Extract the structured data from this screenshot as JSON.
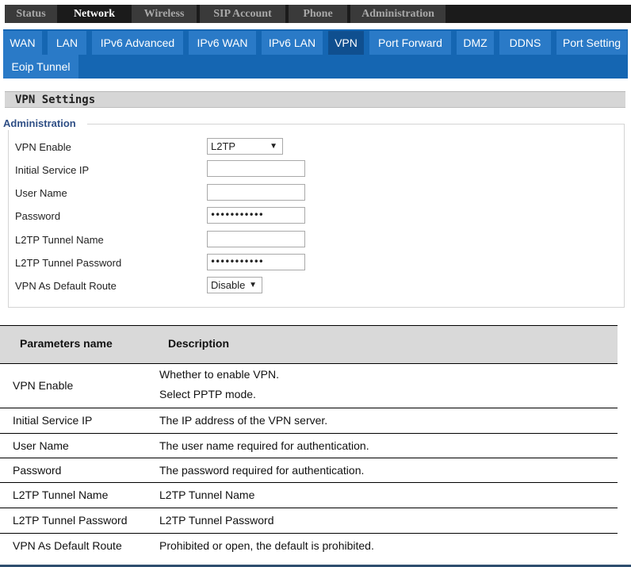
{
  "top_tabs": [
    "Status",
    "Network",
    "Wireless",
    "SIP Account",
    "Phone",
    "Administration"
  ],
  "active_top_tab": "Network",
  "sub_tabs": [
    "WAN",
    "LAN",
    "IPv6 Advanced",
    "IPv6 WAN",
    "IPv6 LAN",
    "VPN",
    "Port Forward",
    "DMZ",
    "DDNS",
    "Port Setting",
    "Eoip Tunnel"
  ],
  "active_sub_tab": "VPN",
  "section_title": "VPN Settings",
  "fieldset_legend": "Administration",
  "form": {
    "vpn_enable": {
      "label": "VPN Enable",
      "value": "L2TP"
    },
    "initial_service_ip": {
      "label": "Initial Service IP",
      "value": ""
    },
    "user_name": {
      "label": "User Name",
      "value": ""
    },
    "password": {
      "label": "Password",
      "value": "•••••••••••"
    },
    "l2tp_tunnel_name": {
      "label": "L2TP Tunnel Name",
      "value": ""
    },
    "l2tp_tunnel_password": {
      "label": "L2TP Tunnel Password",
      "value": "•••••••••••"
    },
    "vpn_default_route": {
      "label": "VPN As Default Route",
      "value": "Disable"
    }
  },
  "table": {
    "headers": [
      "Parameters name",
      "Description"
    ],
    "rows": [
      {
        "name": "VPN Enable",
        "desc": [
          "Whether to enable VPN.",
          "Select PPTP mode."
        ]
      },
      {
        "name": "Initial Service IP",
        "desc": [
          "The IP address of the VPN server."
        ]
      },
      {
        "name": "User Name",
        "desc": [
          "The user name required for authentication."
        ]
      },
      {
        "name": "Password",
        "desc": [
          "The password required for authentication."
        ]
      },
      {
        "name": "L2TP Tunnel Name",
        "desc": [
          "L2TP Tunnel Name"
        ]
      },
      {
        "name": "L2TP Tunnel Password",
        "desc": [
          "L2TP Tunnel Password"
        ]
      },
      {
        "name": "VPN As Default Route",
        "desc": [
          "Prohibited or open, the default is prohibited."
        ]
      }
    ]
  },
  "colors": {
    "top_bar": "#1b1b1b",
    "sub_nav": "#1566b2",
    "legend_text": "#2f4f86",
    "table_header": "#d9d9d9"
  }
}
